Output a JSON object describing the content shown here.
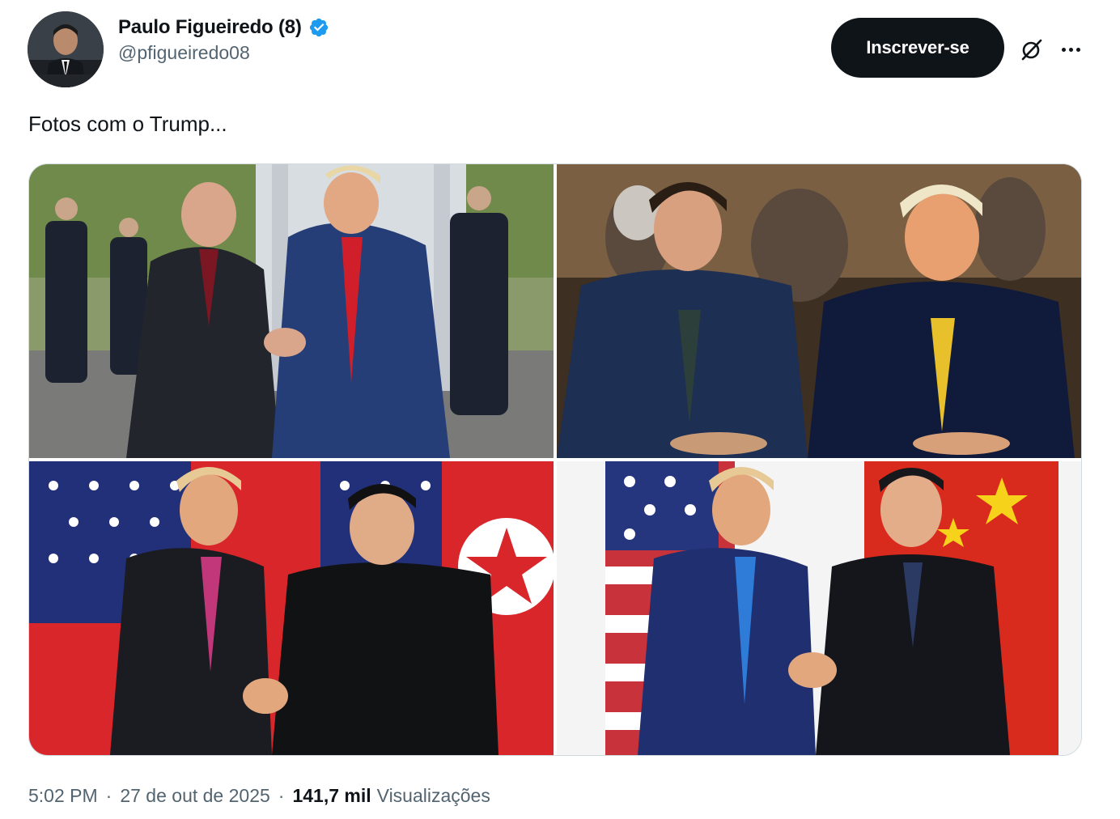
{
  "author": {
    "display_name": "Paulo Figueiredo (8)",
    "handle": "@pfigueiredo08",
    "verified_icon": "verified-badge-icon",
    "badge_color": "#1d9bf0"
  },
  "actions": {
    "subscribe_label": "Inscrever-se",
    "grok_icon": "grok-icon",
    "more_icon": "more-options-icon"
  },
  "tweet": {
    "text": "Fotos com o Trump..."
  },
  "media": [
    {
      "icon": "photo-handshake-airfield"
    },
    {
      "icon": "photo-seated-dinner"
    },
    {
      "icon": "photo-handshake-flags-red-star"
    },
    {
      "icon": "photo-handshake-flags-g20-2019"
    }
  ],
  "meta": {
    "time": "5:02 PM",
    "separator": "·",
    "date": "27 de out de 2025",
    "dot": "·",
    "views_count": "141,7 mil",
    "views_label": "Visualizações"
  },
  "colors": {
    "text_primary": "#0f1419",
    "text_secondary": "#536471",
    "button_bg": "#0f1419",
    "border": "#cfd9de"
  }
}
